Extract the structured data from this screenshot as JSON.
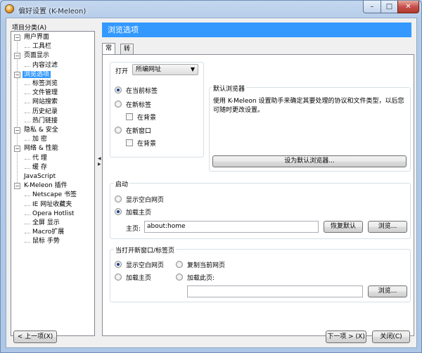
{
  "window": {
    "title": "偏好设置 (K-Meleon)",
    "min_glyph": "–",
    "max_glyph": "□",
    "close_glyph": "✕"
  },
  "sidebar": {
    "label": "项目分类(A)",
    "items": [
      {
        "label": "用户界面",
        "level": 0,
        "expander": "−"
      },
      {
        "label": "工具栏",
        "level": 1
      },
      {
        "label": "页面显示",
        "level": 0,
        "expander": "−"
      },
      {
        "label": "内容过滤",
        "level": 1
      },
      {
        "label": "浏览选项",
        "level": 0,
        "expander": "−",
        "selected": true
      },
      {
        "label": "标签浏览",
        "level": 1
      },
      {
        "label": "文件管理",
        "level": 1
      },
      {
        "label": "网站搜索",
        "level": 1
      },
      {
        "label": "历史纪录",
        "level": 1
      },
      {
        "label": "热门链接",
        "level": 1
      },
      {
        "label": "隐私 & 安全",
        "level": 0,
        "expander": "−"
      },
      {
        "label": "加 密",
        "level": 1
      },
      {
        "label": "网络 & 性能",
        "level": 0,
        "expander": "−"
      },
      {
        "label": "代 理",
        "level": 1
      },
      {
        "label": "缓 存",
        "level": 1
      },
      {
        "label": "JavaScript",
        "level": 0
      },
      {
        "label": "K-Meleon 插件",
        "level": 0,
        "expander": "−"
      },
      {
        "label": "Netscape 书签",
        "level": 1
      },
      {
        "label": "IE 网址收藏夹",
        "level": 1
      },
      {
        "label": "Opera Hotlist",
        "level": 1
      },
      {
        "label": "全屏 显示",
        "level": 1
      },
      {
        "label": "Macro扩展",
        "level": 1
      },
      {
        "label": "鼠标 手势",
        "level": 1
      }
    ]
  },
  "panel": {
    "header": "浏览选项",
    "tabs": [
      {
        "label": "常规",
        "active": true
      },
      {
        "label": "转向窗口",
        "active": false
      }
    ],
    "open": {
      "label": "打开",
      "select_value": "所编网址",
      "radio_current_tab": "在当前标签",
      "radio_new_tab": "在新标签",
      "check_bg_tab": "在背景",
      "radio_new_window": "在新窗口",
      "check_bg_window": "在背景",
      "selected": "current_tab"
    },
    "default_browser": {
      "title": "默认浏览器",
      "description": "使用 K-Meleon 设置助手来确定其要处理的协议和文件类型，以后您可随时更改设置。",
      "button": "设为默认浏览器..."
    },
    "startup": {
      "title": "启动",
      "radio_blank": "显示空白网页",
      "radio_home": "加载主页",
      "selected": "home",
      "home_label": "主页:",
      "home_value": "about:home",
      "restore_button": "恢复默认",
      "browse_button": "浏览..."
    },
    "new_window": {
      "title": "当打开新窗口/标签页",
      "radio_blank": "显示空白网页",
      "radio_home": "加载主页",
      "radio_copy": "复制当前网页",
      "radio_load": "加载此页:",
      "selected": "blank",
      "load_value": "",
      "browse_button": "浏览..."
    }
  },
  "footer": {
    "prev_button": "< 上一项(X)",
    "next_button": "下一项 > (X)",
    "close_button": "关闭(C)"
  }
}
